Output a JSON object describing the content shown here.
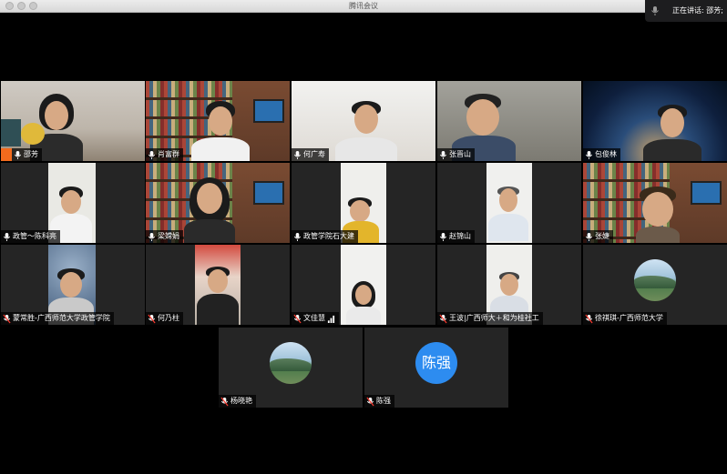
{
  "window": {
    "title": "腾讯会议"
  },
  "speaking": {
    "label": "正在讲话: 邵芳;"
  },
  "participants": [
    {
      "name": "邵芳",
      "active": true
    },
    {
      "name": "肖富群"
    },
    {
      "name": "何广寿"
    },
    {
      "name": "张晋山"
    },
    {
      "name": "包俊林"
    },
    {
      "name": "政管～陈科亮"
    },
    {
      "name": "梁嫦娟"
    },
    {
      "name": "政管学院石大建"
    },
    {
      "name": "赵锦山"
    },
    {
      "name": "张婕"
    },
    {
      "name": "蒙常胜-广西师范大学政管学院"
    },
    {
      "name": "何乃柱"
    },
    {
      "name": "文佳慧"
    },
    {
      "name": "王波|广西师大＋和为桂社工"
    },
    {
      "name": "徐祺琪-广西师范大学"
    },
    {
      "name": "杨晓艳"
    },
    {
      "name": "陈强",
      "avatar_text": "陈强"
    }
  ],
  "colors": {
    "active_border": "#34c759",
    "avatar_blue": "#2d8cf0",
    "host_badge": "#f26b1d"
  }
}
